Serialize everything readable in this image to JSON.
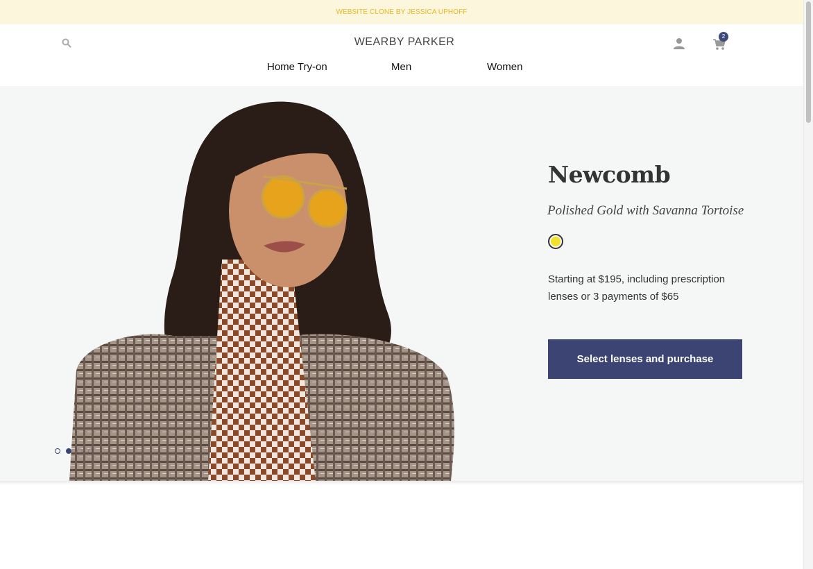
{
  "banner": {
    "text": "WEBSITE CLONE BY JESSICA UPHOFF"
  },
  "header": {
    "logo": "WEARBY PARKER",
    "cart_count": "2",
    "icons": {
      "search": "search-icon",
      "account": "user-icon",
      "cart": "cart-icon"
    }
  },
  "nav": {
    "items": [
      {
        "label": "Home Try-on"
      },
      {
        "label": "Men"
      },
      {
        "label": "Women"
      }
    ]
  },
  "product": {
    "name": "Newcomb",
    "color_name": "Polished Gold with Savanna Tortoise",
    "swatch_color": "#f3e02a",
    "price_text": "Starting at $195, including prescription lenses or 3 payments of $65",
    "cta_label": "Select lenses and purchase"
  },
  "carousel": {
    "slide_count": 4,
    "active_index": 1
  },
  "colors": {
    "accent": "#3b4472",
    "banner_bg": "#fbf6dc",
    "banner_text": "#e6b820"
  }
}
